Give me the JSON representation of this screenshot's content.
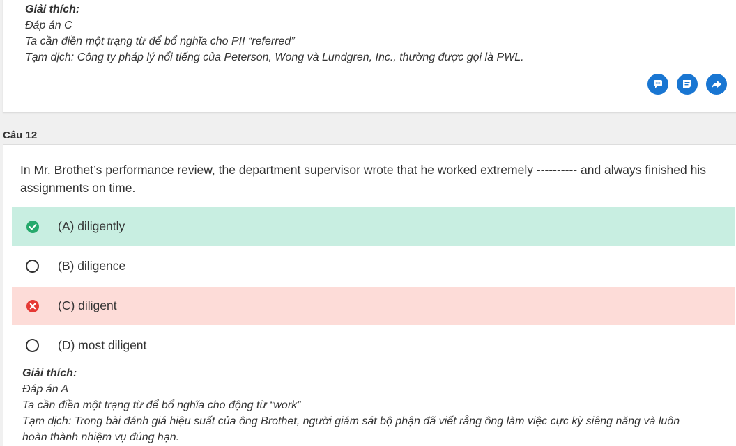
{
  "prev_explanation": {
    "title": "Giải thích:",
    "answer": "Đáp án C",
    "reason": "Ta cần điền một trạng từ để bổ nghĩa cho PII “referred”",
    "translation": "Tạm dịch: Công ty pháp lý nổi tiếng của Peterson, Wong và Lundgren, Inc., thường được gọi là PWL."
  },
  "actions": [
    {
      "icon": "comment-icon"
    },
    {
      "icon": "note-icon"
    },
    {
      "icon": "share-icon"
    }
  ],
  "question": {
    "label": "Câu 12",
    "stem": "In Mr. Brothet’s performance review, the department supervisor wrote that he worked extremely ---------- and always finished his assignments on time.",
    "options": [
      {
        "text": "(A) diligently",
        "state": "correct"
      },
      {
        "text": "(B) diligence",
        "state": "none"
      },
      {
        "text": "(C) diligent",
        "state": "wrong"
      },
      {
        "text": "(D) most diligent",
        "state": "none"
      }
    ],
    "explanation": {
      "title": "Giải thích:",
      "answer": "Đáp án A",
      "reason": "Ta cần điền một trạng từ để bổ nghĩa cho động từ “work”",
      "translation_line1": "Tạm dịch: Trong bài đánh giá hiệu suất của ông Brothet, người giám sát bộ phận đã viết rằng ông làm việc cực kỳ siêng năng và luôn",
      "translation_line2": "hoàn thành nhiệm vụ đúng hạn."
    }
  },
  "colors": {
    "accent": "#1976d2",
    "correct_bg": "#c8eee1",
    "correct_icon": "#26a96c",
    "wrong_bg": "#fddcd8",
    "wrong_icon": "#e53935"
  }
}
